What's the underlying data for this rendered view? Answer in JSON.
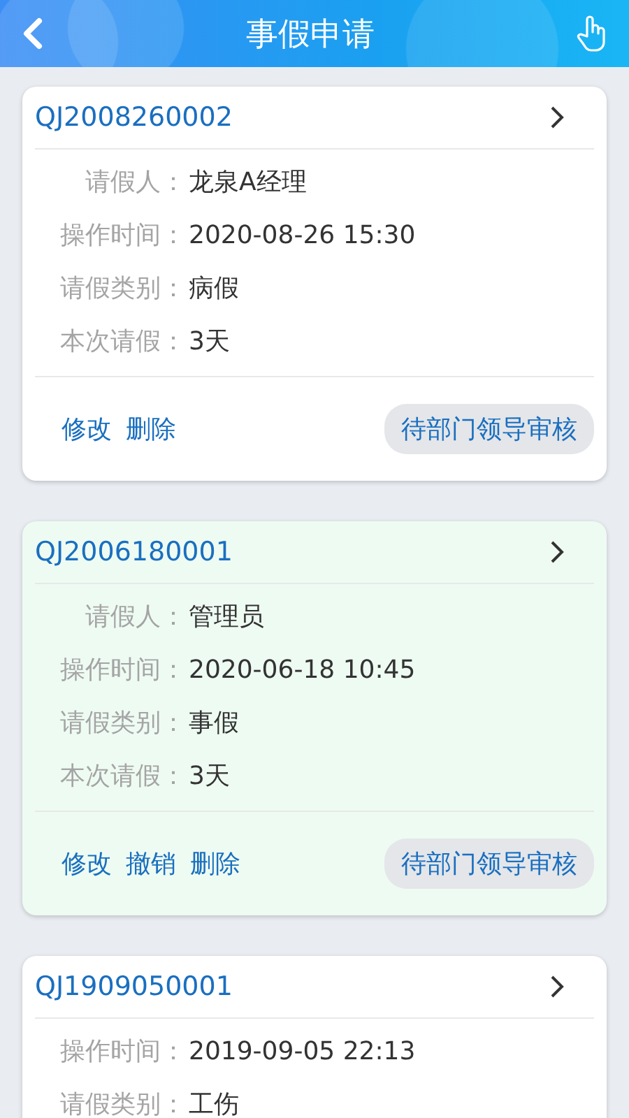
{
  "header": {
    "title": "事假申请"
  },
  "cards": [
    {
      "code": "QJ2008260002",
      "highlighted": false,
      "fields": [
        {
          "label": "请假人：",
          "value": "龙泉A经理"
        },
        {
          "label": "操作时间：",
          "value": "2020-08-26 15:30"
        },
        {
          "label": "请假类别：",
          "value": "病假"
        },
        {
          "label": "本次请假：",
          "value": "3天"
        }
      ],
      "actions": [
        "修改",
        "删除"
      ],
      "status": "待部门领导审核"
    },
    {
      "code": "QJ2006180001",
      "highlighted": true,
      "fields": [
        {
          "label": "请假人：",
          "value": "管理员"
        },
        {
          "label": "操作时间：",
          "value": "2020-06-18 10:45"
        },
        {
          "label": "请假类别：",
          "value": "事假"
        },
        {
          "label": "本次请假：",
          "value": "3天"
        }
      ],
      "actions": [
        "修改",
        "撤销",
        "删除"
      ],
      "status": "待部门领导审核"
    },
    {
      "code": "QJ1909050001",
      "highlighted": false,
      "fields": [
        {
          "label": "操作时间：",
          "value": "2019-09-05 22:13"
        },
        {
          "label": "请假类别：",
          "value": "工伤"
        }
      ]
    }
  ]
}
